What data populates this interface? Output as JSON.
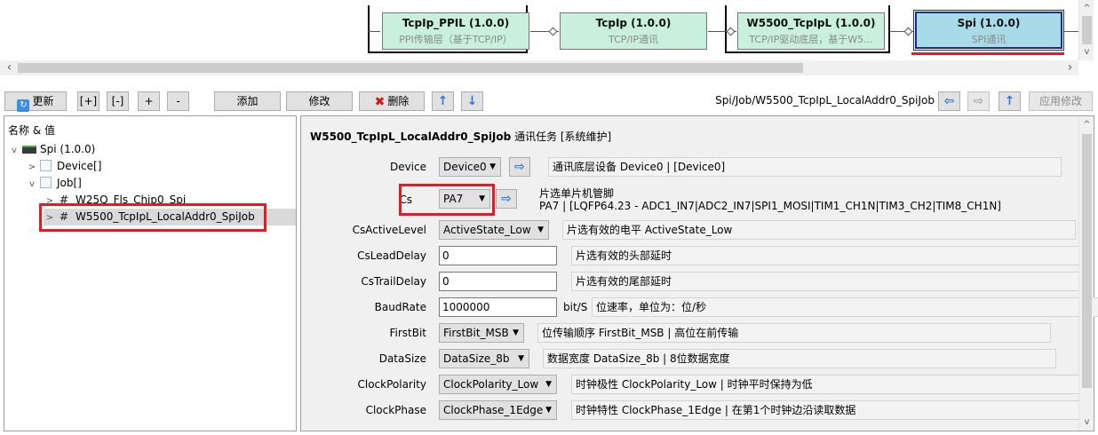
{
  "diagram": {
    "nodes": [
      {
        "title": "TcpIp_PPIL (1.0.0)",
        "subtitle": "PPI传输层（基于TCP/IP）"
      },
      {
        "title": "TcpIp (1.0.0)",
        "subtitle": "TCP/IP通讯"
      },
      {
        "title": "W5500_TcpIpL (1.0.0)",
        "subtitle": "TCP/IP驱动底层，基于W5..."
      },
      {
        "title": "Spi (1.0.0)",
        "subtitle": "SPI通讯"
      }
    ],
    "scroll_left": "‹",
    "scroll_right": "›",
    "scroll_up": "^",
    "scroll_down": "v"
  },
  "toolbar": {
    "refresh": "更新",
    "expand_all": "[+]",
    "collapse_all": "[-]",
    "expand": "+",
    "collapse": "-",
    "add": "添加",
    "modify": "修改",
    "delete": "删除",
    "move_up": "↑",
    "move_down": "↓",
    "path": "Spi/Job/W5500_TcpIpL_LocalAddr0_SpiJob",
    "nav_back": "⇦",
    "nav_forward": "⇨",
    "nav_up": "↑",
    "apply": "应用修改"
  },
  "tree": {
    "header": "名称 & 值",
    "items": [
      {
        "label": "Spi (1.0.0)",
        "twisty": "v"
      },
      {
        "label": "Device[]",
        "twisty": ">"
      },
      {
        "label": "Job[]",
        "twisty": "v"
      },
      {
        "label": "W25Q_Fls_Chip0_Spi",
        "twisty": ">"
      },
      {
        "label": "W5500_TcpIpL_LocalAddr0_SpiJob",
        "twisty": ">"
      }
    ]
  },
  "props": {
    "title_name": "W5500_TcpIpL_LocalAddr0_SpiJob",
    "title_suffix": "通讯任务 [系统维护]",
    "rows": [
      {
        "label": "Device",
        "value": "Device0",
        "desc": "通讯底层设备 Device0 | [Device0]"
      },
      {
        "label": "Cs",
        "value": "PA7",
        "desc1": "片选单片机管脚",
        "desc2": "PA7 | [LQFP64.23 - ADC1_IN7|ADC2_IN7|SPI1_MOSI|TIM1_CH1N|TIM3_CH2|TIM8_CH1N]"
      },
      {
        "label": "CsActiveLevel",
        "value": "ActiveState_Low",
        "desc": "片选有效的电平 ActiveState_Low"
      },
      {
        "label": "CsLeadDelay",
        "value": "0",
        "desc": "片选有效的头部延时"
      },
      {
        "label": "CsTrailDelay",
        "value": "0",
        "desc": "片选有效的尾部延时"
      },
      {
        "label": "BaudRate",
        "value": "1000000",
        "unit": "bit/S",
        "desc": "位速率，单位为：位/秒"
      },
      {
        "label": "FirstBit",
        "value": "FirstBit_MSB",
        "desc": "位传输顺序 FirstBit_MSB | 高位在前传输"
      },
      {
        "label": "DataSize",
        "value": "DataSize_8b",
        "desc": "数据宽度 DataSize_8b | 8位数据宽度"
      },
      {
        "label": "ClockPolarity",
        "value": "ClockPolarity_Low",
        "desc": "时钟极性 ClockPolarity_Low | 时钟平时保持为低"
      },
      {
        "label": "ClockPhase",
        "value": "ClockPhase_1Edge",
        "desc": "时钟特性 ClockPhase_1Edge | 在第1个时钟边沿读取数据"
      }
    ],
    "nav_arrow": "⇨",
    "caret": "▼"
  },
  "colors": {
    "highlight": "#e31b23",
    "node_fill": "#c8f0dc",
    "node_selected": "#a8dbe8",
    "accent": "#2c7bd9"
  }
}
